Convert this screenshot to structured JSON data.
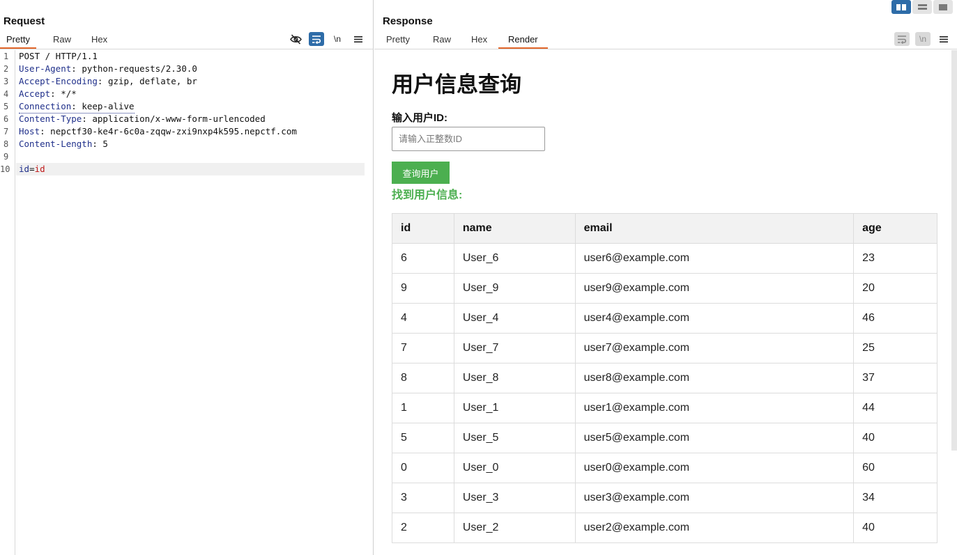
{
  "layout_toggle": [
    "split-horizontal",
    "split-vertical",
    "single"
  ],
  "request": {
    "title": "Request",
    "tabs": [
      "Pretty",
      "Raw",
      "Hex"
    ],
    "active_tab": 0,
    "tools": {
      "hide_icon": "eye-slash-icon",
      "wrap_icon": "wrap-lines-icon",
      "newline_label": "\\n",
      "menu_icon": "hamburger-menu-icon"
    },
    "lines": [
      {
        "n": "1",
        "key": "",
        "sep": "",
        "val": "POST / HTTP/1.1"
      },
      {
        "n": "2",
        "key": "User-Agent",
        "sep": ": ",
        "val": "python-requests/2.30.0"
      },
      {
        "n": "3",
        "key": "Accept-Encoding",
        "sep": ": ",
        "val": "gzip, deflate, br"
      },
      {
        "n": "4",
        "key": "Accept",
        "sep": ": ",
        "val": "*/*"
      },
      {
        "n": "5",
        "key": "Connection",
        "sep": ": ",
        "val": "keep-alive"
      },
      {
        "n": "6",
        "key": "Content-Type",
        "sep": ": ",
        "val": "application/x-www-form-urlencoded"
      },
      {
        "n": "7",
        "key": "Host",
        "sep": ": ",
        "val": "nepctf30-ke4r-6c0a-zqqw-zxi9nxp4k595.nepctf.com"
      },
      {
        "n": "8",
        "key": "Content-Length",
        "sep": ": ",
        "val": "5"
      },
      {
        "n": "9",
        "key": "",
        "sep": "",
        "val": ""
      },
      {
        "n": "10",
        "key": "id",
        "sep": "=",
        "val": "id"
      }
    ]
  },
  "response": {
    "title": "Response",
    "tabs": [
      "Pretty",
      "Raw",
      "Hex",
      "Render"
    ],
    "active_tab": 3,
    "tools": {
      "wrap_icon": "wrap-lines-icon",
      "newline_label": "\\n",
      "menu_icon": "hamburger-menu-icon"
    },
    "render": {
      "heading": "用户信息查询",
      "input_label": "输入用户ID:",
      "input_placeholder": "请输入正整数ID",
      "button_label": "查询用户",
      "found_text": "找到用户信息:",
      "columns": [
        "id",
        "name",
        "email",
        "age"
      ],
      "rows": [
        [
          "6",
          "User_6",
          "user6@example.com",
          "23"
        ],
        [
          "9",
          "User_9",
          "user9@example.com",
          "20"
        ],
        [
          "4",
          "User_4",
          "user4@example.com",
          "46"
        ],
        [
          "7",
          "User_7",
          "user7@example.com",
          "25"
        ],
        [
          "8",
          "User_8",
          "user8@example.com",
          "37"
        ],
        [
          "1",
          "User_1",
          "user1@example.com",
          "44"
        ],
        [
          "5",
          "User_5",
          "user5@example.com",
          "40"
        ],
        [
          "0",
          "User_0",
          "user0@example.com",
          "60"
        ],
        [
          "3",
          "User_3",
          "user3@example.com",
          "34"
        ],
        [
          "2",
          "User_2",
          "user2@example.com",
          "40"
        ]
      ]
    }
  },
  "colors": {
    "accent_tab": "#e2662a",
    "tool_active": "#2e6ca8",
    "render_button": "#4caf50",
    "header_key": "#1f2f8a",
    "param_value": "#c01919"
  }
}
